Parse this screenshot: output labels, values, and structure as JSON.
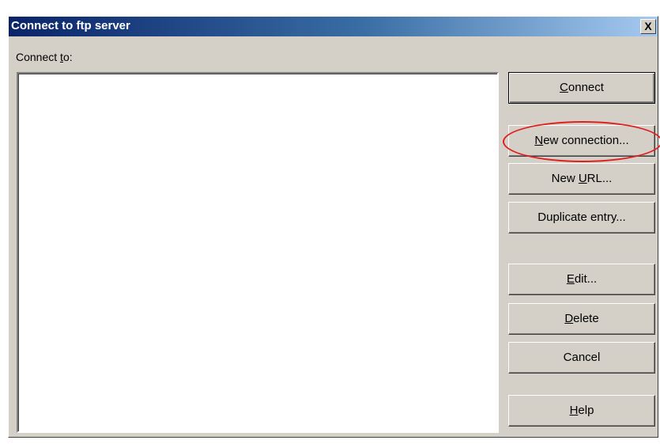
{
  "window": {
    "title": "Connect to ftp server",
    "close_glyph": "X"
  },
  "connect_to": {
    "label_pre": "Connect ",
    "label_access": "t",
    "label_post": "o:"
  },
  "buttons": {
    "connect": {
      "access": "C",
      "rest": "onnect"
    },
    "new_connection": {
      "access": "N",
      "rest": "ew connection..."
    },
    "new_url": {
      "pre": "New ",
      "access": "U",
      "rest": "RL..."
    },
    "duplicate_entry": {
      "label": "Duplicate entry..."
    },
    "edit": {
      "access": "E",
      "rest": "dit..."
    },
    "delete": {
      "access": "D",
      "rest": "elete"
    },
    "cancel": {
      "label": "Cancel"
    },
    "help": {
      "access": "H",
      "rest": "elp"
    }
  },
  "annotation": {
    "highlight_color": "#e02020"
  },
  "colors": {
    "titlebar_start": "#0a246a",
    "titlebar_end": "#a6caf0",
    "dialog_face": "#d4d0c8"
  }
}
